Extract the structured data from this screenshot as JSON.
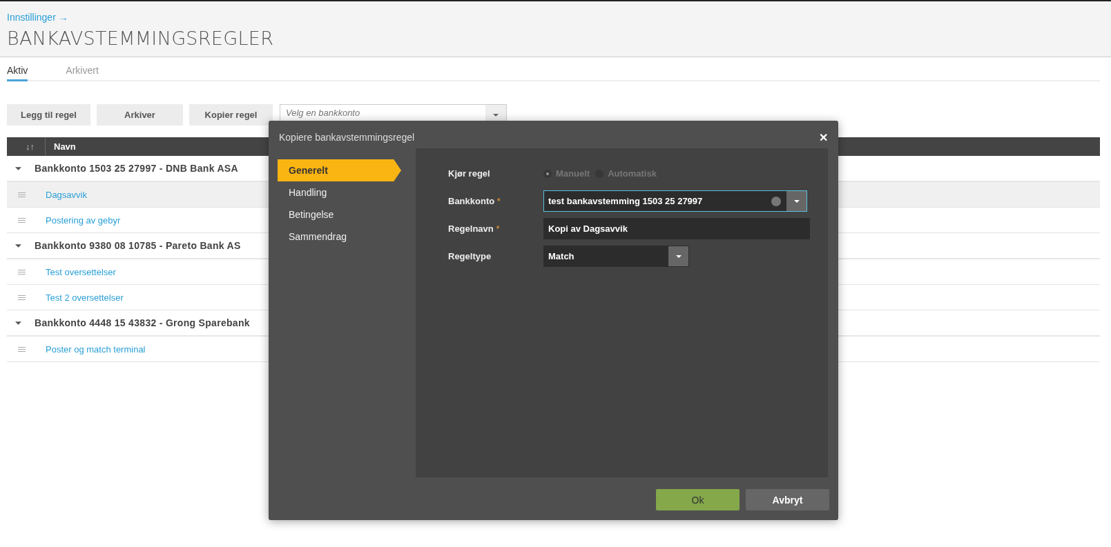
{
  "breadcrumb": {
    "label": "Innstillinger",
    "arrow": "→"
  },
  "title": "BANKAVSTEMMINGSREGLER",
  "tabs": [
    {
      "label": "Aktiv",
      "selected": true
    },
    {
      "label": "Arkivert",
      "selected": false
    }
  ],
  "toolbar": {
    "buttons": [
      "Legg til regel",
      "Arkiver",
      "Kopier regel"
    ],
    "account_select": {
      "placeholder": "Velg en bankkonto"
    }
  },
  "table": {
    "columns": [
      {
        "label": "↓↑"
      },
      {
        "label": "Navn"
      }
    ],
    "groups": [
      {
        "label": "Bankkonto 1503 25 27997 - DNB Bank ASA",
        "expanded": true,
        "rows": [
          {
            "name": "Dagsavvik",
            "selected": true
          },
          {
            "name": "Postering av gebyr",
            "selected": false
          }
        ]
      },
      {
        "label": "Bankkonto 9380 08 10785 - Pareto Bank AS",
        "expanded": true,
        "rows": [
          {
            "name": "Test oversettelser",
            "selected": false
          },
          {
            "name": "Test 2 oversettelser",
            "selected": false
          }
        ]
      },
      {
        "label": "Bankkonto 4448 15 43832 - Grong Sparebank",
        "expanded": true,
        "rows": [
          {
            "name": "Poster og match terminal",
            "selected": false
          }
        ]
      }
    ]
  },
  "dialog": {
    "title": "Kopiere bankavstemmingsregel",
    "close": "✕",
    "steps": [
      {
        "label": "Generelt",
        "selected": true
      },
      {
        "label": "Handling",
        "selected": false
      },
      {
        "label": "Betingelse",
        "selected": false
      },
      {
        "label": "Sammendrag",
        "selected": false
      }
    ],
    "fields": [
      {
        "kind": "radio",
        "label": "Kjør regel",
        "disabled": true,
        "options": [
          {
            "label": "Manuelt",
            "selected": true
          },
          {
            "label": "Automatisk",
            "selected": false
          }
        ]
      },
      {
        "kind": "combo",
        "label": "Bankkonto",
        "required_mark": "*",
        "value": "test bankavstemming 1503 25 27997",
        "focused": true
      },
      {
        "kind": "text",
        "label": "Regelnavn",
        "required_mark": "*",
        "value": "Kopi av Dagsavvik"
      },
      {
        "kind": "select",
        "label": "Regeltype",
        "value": "Match"
      }
    ],
    "buttons": [
      {
        "label": "Ok",
        "kind": "primary"
      },
      {
        "label": "Avbryt",
        "kind": "secondary"
      }
    ]
  }
}
